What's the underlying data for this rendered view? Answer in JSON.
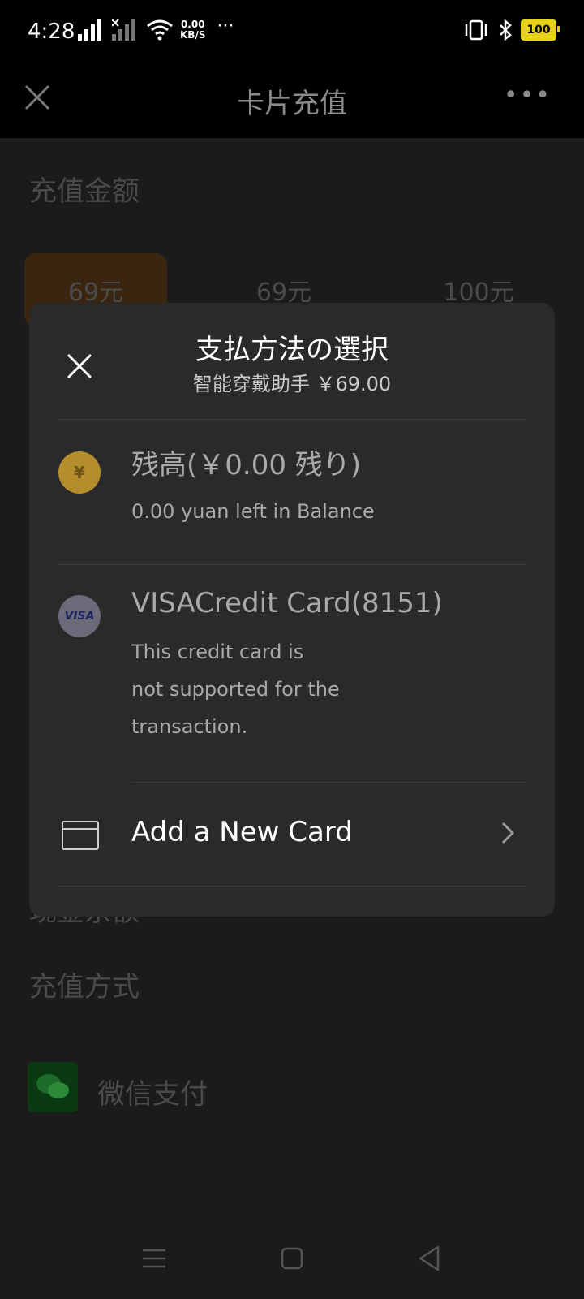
{
  "status_bar": {
    "time": "4:28",
    "net_speed_value": "0.00",
    "net_speed_unit": "KB/S",
    "battery": "100"
  },
  "header": {
    "title": "卡片充值"
  },
  "background": {
    "recharge_amount_title": "充值金额",
    "amounts": [
      "69元",
      "69元",
      "100元"
    ],
    "cash_balance": "现金余额",
    "recharge_method_title": "充值方式",
    "wechat_pay": "微信支付"
  },
  "dialog": {
    "title": "支払方法の選択",
    "subtitle": "智能穿戴助手 ￥69.00",
    "balance_option": {
      "title": "残高(￥0.00 残り)",
      "subtitle": "0.00 yuan left in Balance"
    },
    "visa_option": {
      "icon_text": "VISA",
      "title": "VISACredit Card(8151)",
      "subtitle_lines": [
        "This credit card is",
        "not supported for the",
        "transaction."
      ]
    },
    "add_card_label": "Add a New Card"
  }
}
